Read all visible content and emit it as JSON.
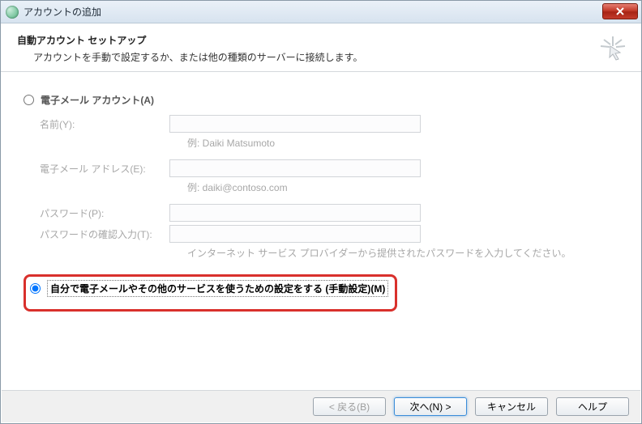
{
  "window": {
    "title": "アカウントの追加"
  },
  "header": {
    "title": "自動アカウント セットアップ",
    "description": "アカウントを手動で設定するか、または他の種類のサーバーに接続します。"
  },
  "options": {
    "email_account": {
      "label": "電子メール アカウント(A)",
      "selected": false
    },
    "manual_setup": {
      "label": "自分で電子メールやその他のサービスを使うための設定をする (手動設定)(M)",
      "selected": true
    }
  },
  "fields": {
    "name": {
      "label": "名前(Y):",
      "example": "例: Daiki Matsumoto",
      "value": ""
    },
    "email": {
      "label": "電子メール アドレス(E):",
      "example": "例: daiki@contoso.com",
      "value": ""
    },
    "password": {
      "label": "パスワード(P):",
      "value": ""
    },
    "password_confirm": {
      "label": "パスワードの確認入力(T):",
      "value": ""
    },
    "password_hint": "インターネット サービス プロバイダーから提供されたパスワードを入力してください。"
  },
  "buttons": {
    "back": "< 戻る(B)",
    "next": "次へ(N) >",
    "cancel": "キャンセル",
    "help": "ヘルプ"
  }
}
